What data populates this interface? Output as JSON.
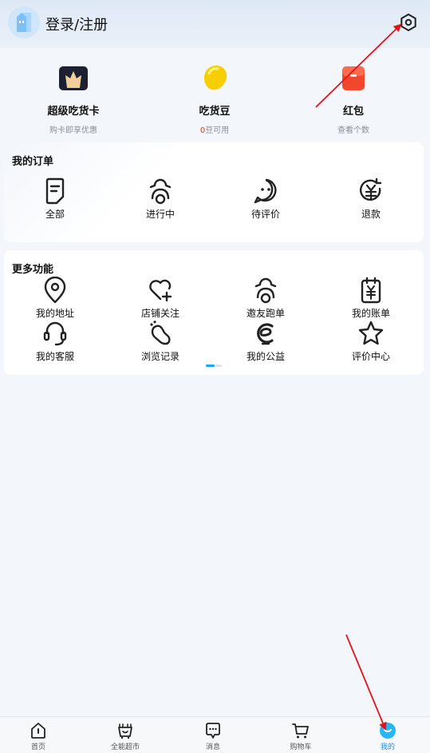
{
  "header": {
    "login_label": "登录/注册"
  },
  "assets": [
    {
      "title": "超级吃货卡",
      "sub": "购卡即享优惠",
      "icon": "super-card-icon"
    },
    {
      "title": "吃货豆",
      "sub_red": "0",
      "sub_rest": "豆可用",
      "icon": "bean-icon"
    },
    {
      "title": "红包",
      "sub": "查看个数",
      "icon": "red-packet-icon"
    }
  ],
  "orders": {
    "title": "我的订单",
    "items": [
      {
        "label": "全部",
        "icon": "all-orders-icon"
      },
      {
        "label": "进行中",
        "icon": "in-progress-icon"
      },
      {
        "label": "待评价",
        "icon": "pending-review-icon"
      },
      {
        "label": "退款",
        "icon": "refund-icon"
      }
    ]
  },
  "more": {
    "title": "更多功能",
    "items": [
      {
        "label": "我的地址",
        "icon": "location-icon"
      },
      {
        "label": "店铺关注",
        "icon": "heart-plus-icon"
      },
      {
        "label": "邀友跑单",
        "icon": "rider-icon"
      },
      {
        "label": "我的账单",
        "icon": "bill-icon"
      },
      {
        "label": "我的客服",
        "icon": "headset-icon"
      },
      {
        "label": "浏览记录",
        "icon": "footprint-icon"
      },
      {
        "label": "我的公益",
        "icon": "charity-icon"
      },
      {
        "label": "评价中心",
        "icon": "star-icon"
      }
    ]
  },
  "tabbar": [
    {
      "label": "首页",
      "icon": "home-icon"
    },
    {
      "label": "全能超市",
      "icon": "supermarket-icon"
    },
    {
      "label": "消息",
      "icon": "message-icon"
    },
    {
      "label": "购物车",
      "icon": "cart-icon"
    },
    {
      "label": "我的",
      "icon": "profile-icon",
      "active": true
    }
  ],
  "colors": {
    "accent": "#1a8ff0",
    "red": "#e8321e",
    "annotation": "#e0141c"
  }
}
